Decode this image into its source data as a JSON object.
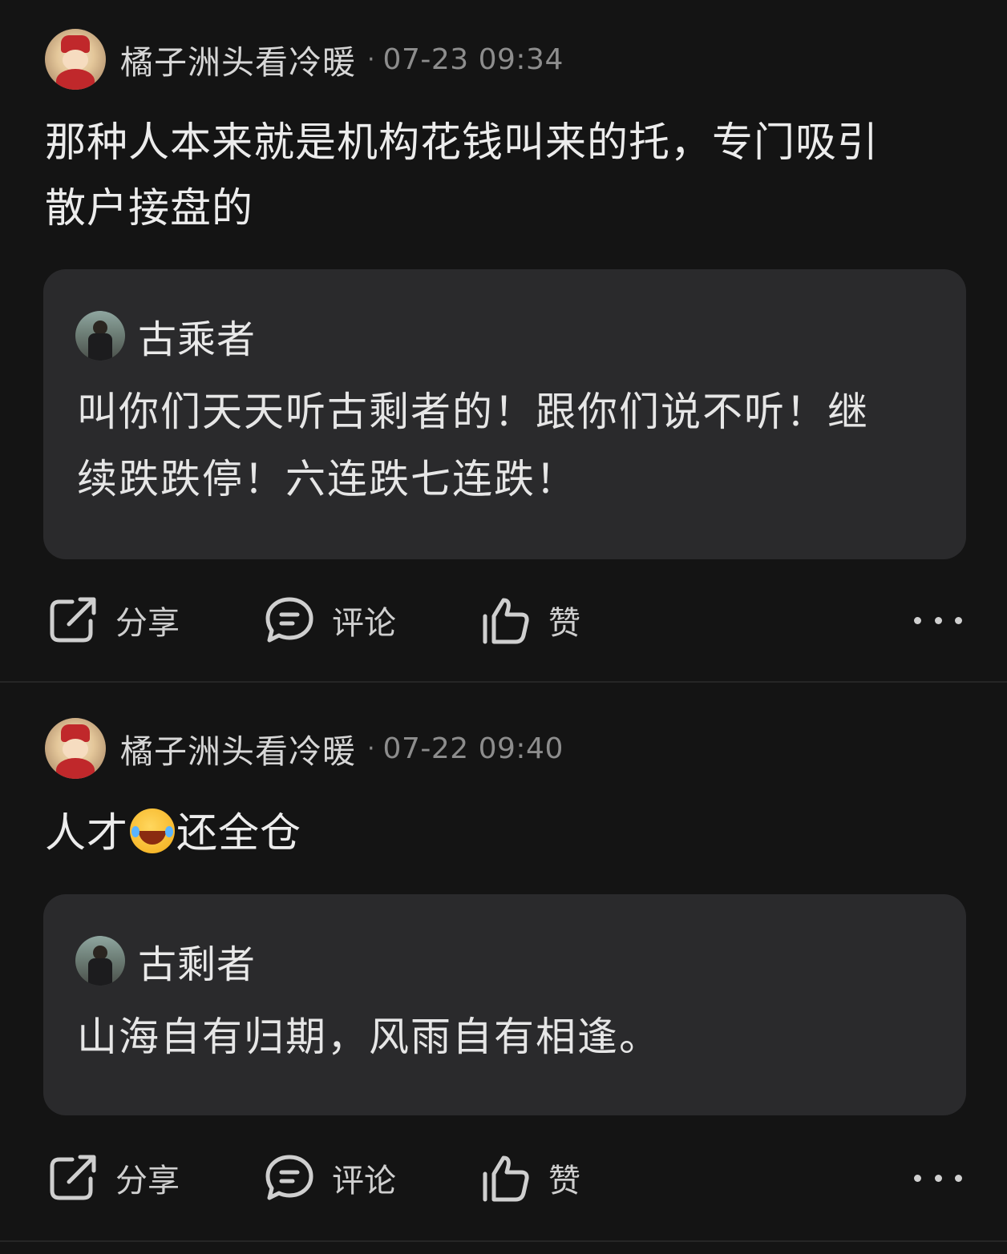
{
  "posts": [
    {
      "author": "橘子洲头看冷暖",
      "separator": "·",
      "time": "07-23 09:34",
      "content_lines": [
        "那种人本来就是机构花钱叫来的托，专门吸引",
        "散户接盘的"
      ],
      "quote": {
        "author": "古乘者",
        "lines": [
          "叫你们天天听古剩者的！跟你们说不听！继",
          "续跌跌停！六连跌七连跌！"
        ]
      },
      "actions": {
        "share": "分享",
        "comment": "评论",
        "like": "赞"
      }
    },
    {
      "author": "橘子洲头看冷暖",
      "separator": "·",
      "time": "07-22 09:40",
      "content_before_emoji": "人才",
      "emoji": "face-with-tears-of-joy",
      "content_after_emoji": "还全仓",
      "quote": {
        "author": "古剩者",
        "lines": [
          "山海自有归期，风雨自有相逢。"
        ]
      },
      "actions": {
        "share": "分享",
        "comment": "评论",
        "like": "赞"
      }
    }
  ],
  "icons": {
    "share": "share-icon",
    "comment": "comment-icon",
    "like": "thumbs-up-icon",
    "more": "more-icon"
  },
  "colors": {
    "background": "#141414",
    "quote_background": "#2a2a2c",
    "text": "#ececec",
    "muted": "#8d8d8d"
  }
}
